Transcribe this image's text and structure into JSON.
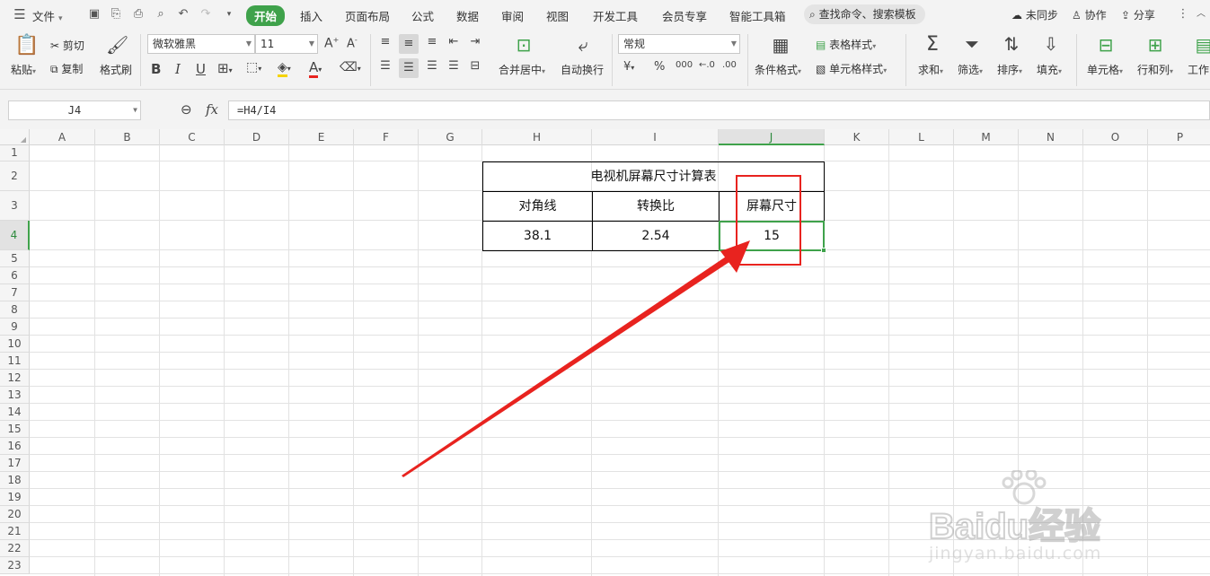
{
  "menubar": {
    "file": "文件",
    "tabs": [
      "开始",
      "插入",
      "页面布局",
      "公式",
      "数据",
      "审阅",
      "视图",
      "开发工具",
      "会员专享",
      "智能工具箱"
    ],
    "search_placeholder": "查找命令、搜索模板",
    "sync": "未同步",
    "collab": "协作",
    "share": "分享"
  },
  "ribbon": {
    "paste": "粘贴",
    "cut": "剪切",
    "copy": "复制",
    "format_painter": "格式刷",
    "font_name": "微软雅黑",
    "font_size": "11",
    "merge_center": "合并居中",
    "wrap_text": "自动换行",
    "number_format": "常规",
    "conditional_format": "条件格式",
    "table_style": "表格样式",
    "cell_style": "单元格样式",
    "sum": "求和",
    "filter": "筛选",
    "sort": "排序",
    "fill": "填充",
    "cell": "单元格",
    "row_col": "行和列",
    "worksheet": "工作"
  },
  "formula_bar": {
    "name_box": "J4",
    "fx": "fx",
    "formula": "=H4/I4"
  },
  "sheet": {
    "columns": [
      "A",
      "B",
      "C",
      "D",
      "E",
      "F",
      "G",
      "H",
      "I",
      "J",
      "K",
      "L",
      "M",
      "N",
      "O",
      "P"
    ],
    "rows": [
      "1",
      "2",
      "3",
      "4",
      "5",
      "6",
      "7",
      "8",
      "9",
      "10",
      "11",
      "12",
      "13",
      "14",
      "15",
      "16",
      "17",
      "18",
      "19",
      "20",
      "21",
      "22",
      "23"
    ],
    "selected_column": "J",
    "selected_row": "4",
    "table": {
      "title": "电视机屏幕尺寸计算表",
      "headers": [
        "对角线",
        "转换比",
        "屏幕尺寸"
      ],
      "values": [
        "38.1",
        "2.54",
        "15"
      ]
    }
  },
  "annotation": {
    "highlight_color": "#e8231f",
    "selection_color": "#3fa24b"
  },
  "watermark": {
    "brand": "Baidu经验",
    "url": "jingyan.baidu.com"
  }
}
